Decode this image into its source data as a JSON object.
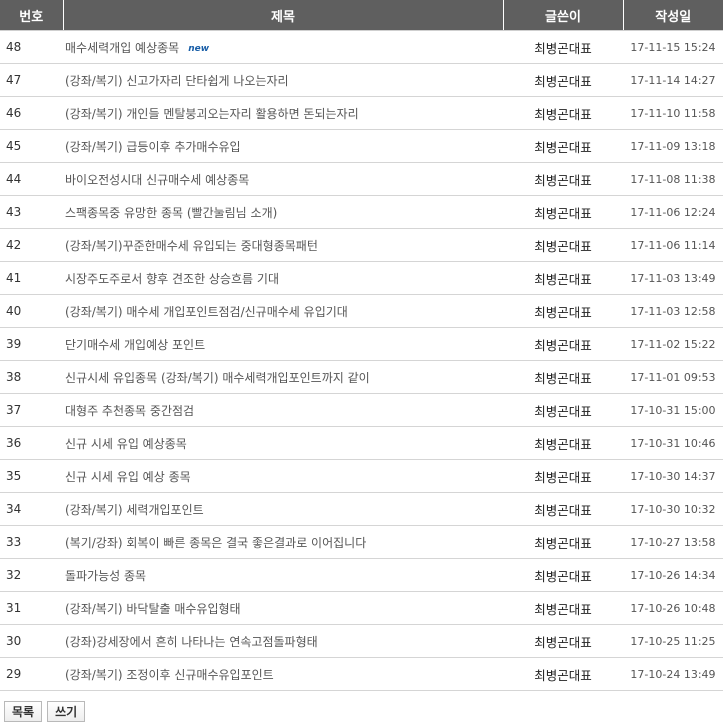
{
  "table": {
    "headers": {
      "num": "번호",
      "title": "제목",
      "writer": "글쓴이",
      "date": "작성일"
    },
    "new_badge": "new",
    "rows": [
      {
        "num": "48",
        "title": "매수세력개입 예상종목",
        "writer": "최병곤대표",
        "date": "17-11-15 15:24",
        "is_new": true
      },
      {
        "num": "47",
        "title": "(강좌/복기) 신고가자리 단타쉽게 나오는자리",
        "writer": "최병곤대표",
        "date": "17-11-14 14:27"
      },
      {
        "num": "46",
        "title": "(강좌/복기) 개인들 멘탈붕괴오는자리 활용하면 돈되는자리",
        "writer": "최병곤대표",
        "date": "17-11-10 11:58"
      },
      {
        "num": "45",
        "title": "(강좌/복기) 급등이후 추가매수유입",
        "writer": "최병곤대표",
        "date": "17-11-09 13:18"
      },
      {
        "num": "44",
        "title": "바이오전성시대 신규매수세 예상종목",
        "writer": "최병곤대표",
        "date": "17-11-08 11:38"
      },
      {
        "num": "43",
        "title": "스팩종목중 유망한 종목 (빨간눌림님 소개)",
        "writer": "최병곤대표",
        "date": "17-11-06 12:24"
      },
      {
        "num": "42",
        "title": "(강좌/복기)꾸준한매수세 유입되는 중대형종목패턴",
        "writer": "최병곤대표",
        "date": "17-11-06 11:14"
      },
      {
        "num": "41",
        "title": "시장주도주로서 향후 견조한 상승흐름 기대",
        "writer": "최병곤대표",
        "date": "17-11-03 13:49"
      },
      {
        "num": "40",
        "title": "(강좌/복기) 매수세 개입포인트점검/신규매수세 유입기대",
        "writer": "최병곤대표",
        "date": "17-11-03 12:58"
      },
      {
        "num": "39",
        "title": "단기매수세 개입예상 포인트",
        "writer": "최병곤대표",
        "date": "17-11-02 15:22"
      },
      {
        "num": "38",
        "title": "신규시세 유입종목 (강좌/복기) 매수세력개입포인트까지 같이",
        "writer": "최병곤대표",
        "date": "17-11-01 09:53"
      },
      {
        "num": "37",
        "title": "대형주 추천종목 중간점검",
        "writer": "최병곤대표",
        "date": "17-10-31 15:00"
      },
      {
        "num": "36",
        "title": "신규 시세 유입 예상종목",
        "writer": "최병곤대표",
        "date": "17-10-31 10:46"
      },
      {
        "num": "35",
        "title": "신규 시세 유입 예상 종목",
        "writer": "최병곤대표",
        "date": "17-10-30 14:37"
      },
      {
        "num": "34",
        "title": "(강좌/복기) 세력개입포인트",
        "writer": "최병곤대표",
        "date": "17-10-30 10:32"
      },
      {
        "num": "33",
        "title": "(복기/강좌) 회복이 빠른 종목은 결국 좋은결과로 이어집니다",
        "writer": "최병곤대표",
        "date": "17-10-27 13:58"
      },
      {
        "num": "32",
        "title": "돌파가능성 종목",
        "writer": "최병곤대표",
        "date": "17-10-26 14:34"
      },
      {
        "num": "31",
        "title": "(강좌/복기) 바닥탈출 매수유입형태",
        "writer": "최병곤대표",
        "date": "17-10-26 10:48"
      },
      {
        "num": "30",
        "title": "(강좌)강세장에서 흔히 나타나는 연속고점돌파형태",
        "writer": "최병곤대표",
        "date": "17-10-25 11:25"
      },
      {
        "num": "29",
        "title": "(강좌/복기) 조정이후 신규매수유입포인트",
        "writer": "최병곤대표",
        "date": "17-10-24 13:49"
      }
    ]
  },
  "buttons": {
    "list_label": "목록",
    "write_label": "쓰기"
  }
}
